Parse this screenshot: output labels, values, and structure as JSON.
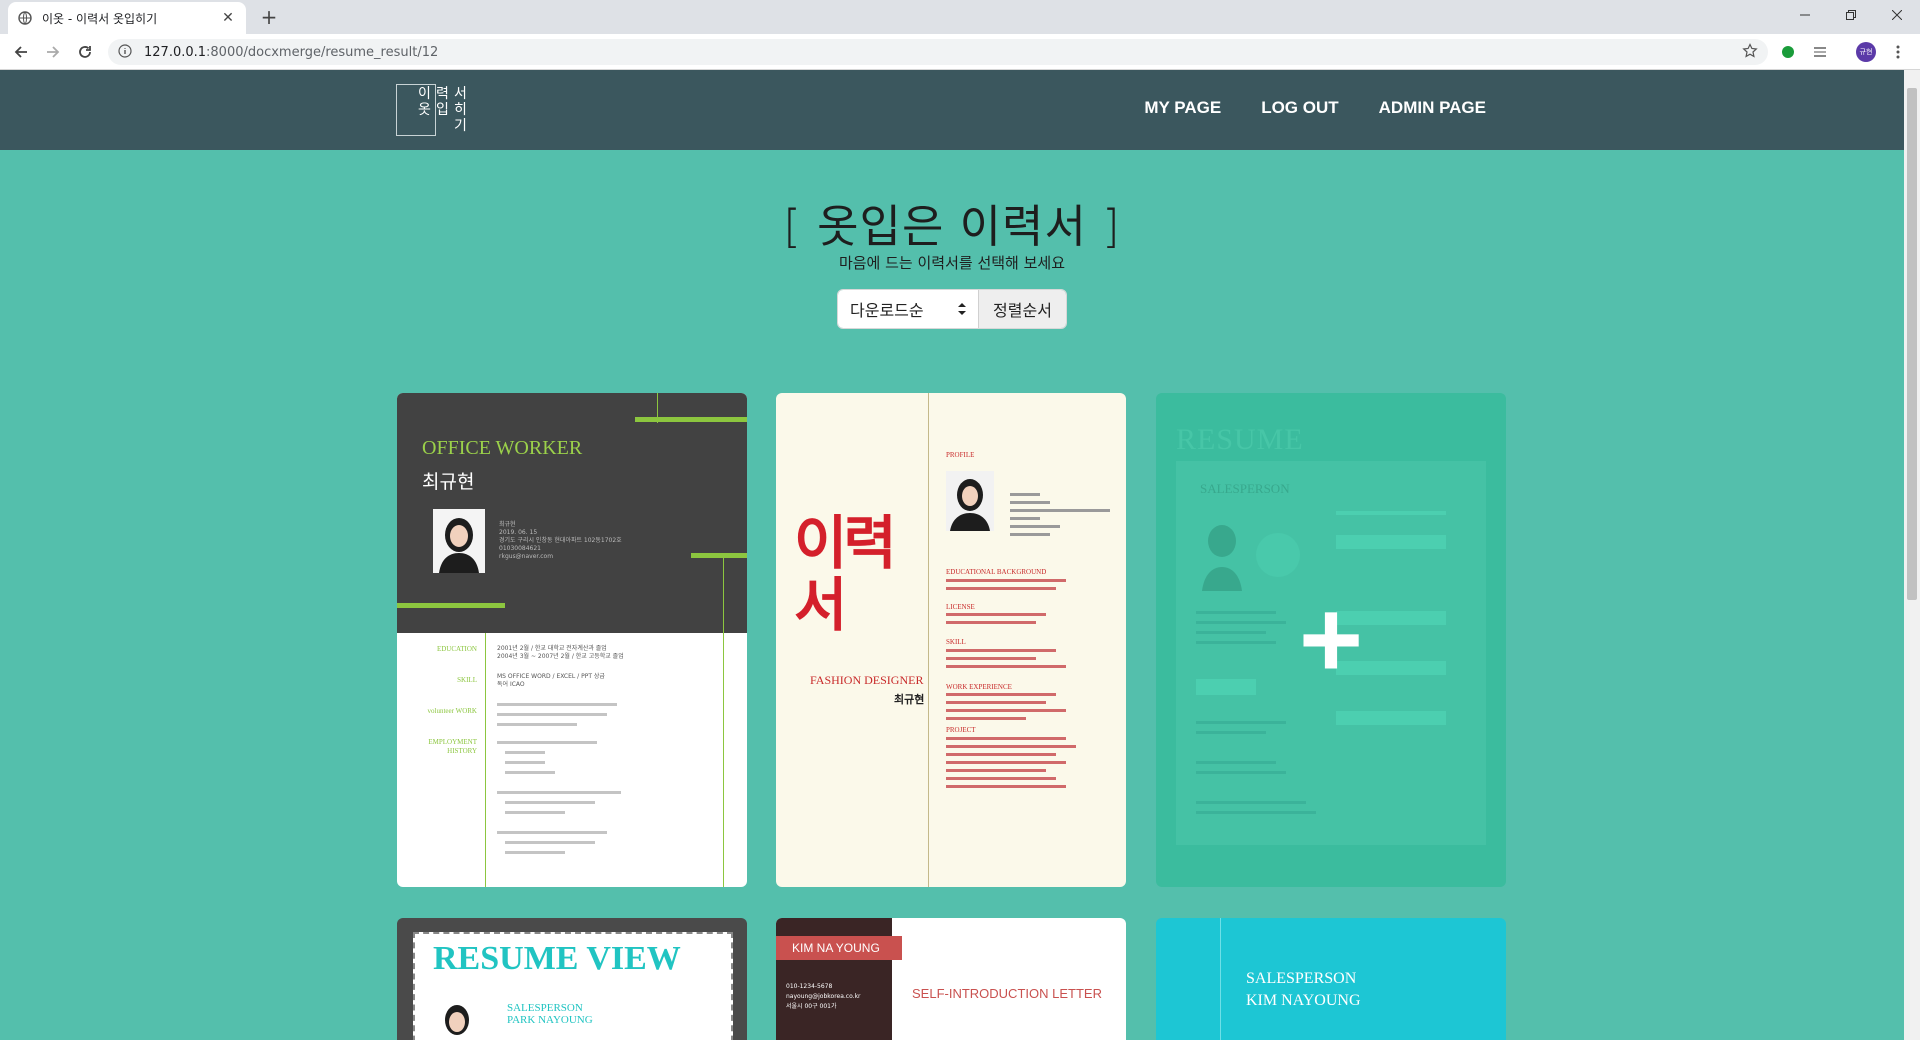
{
  "browser": {
    "tab_title": "이옷 - 이력서 옷입히기",
    "url_host": "127.0.0.1",
    "url_rest": ":8000/docxmerge/resume_result/12",
    "new_tab_symbol": "+",
    "close_symbol": "✕",
    "ext_label": "규현"
  },
  "header": {
    "logo_chars": [
      "이",
      "옷",
      "력",
      "입",
      "서",
      "히",
      "기"
    ],
    "nav": [
      "MY PAGE",
      "LOG OUT",
      "ADMIN PAGE"
    ]
  },
  "main": {
    "title": "[ 옷입은 이력서 ]",
    "subtitle": "마음에 드는 이력서를 선택해 보세요",
    "sort_selected": "다운로드순",
    "sort_button": "정렬순서"
  },
  "cards": {
    "office": {
      "heading": "OFFICE WORKER",
      "name": "최규현",
      "info": [
        "최규현",
        "2019. 06. 15",
        "경기도 구리시 인창동 현대아파트 102동1702호",
        "01030084621",
        "rkgus@naver.com"
      ],
      "sections": [
        "EDUCATION",
        "SKILL",
        "volunteer WORK",
        "EMPLOYMENT HISTORY"
      ],
      "edu": [
        "2001년 2월 / 한교 대학교 전자계산과 졸업",
        "2004년 3월 ~ 2007년 2월 / 한교 고등학교 졸업"
      ],
      "skill": [
        "MS OFFICE WORD / EXCEL / PPT 상급",
        "독어 ICAO"
      ]
    },
    "fashion": {
      "big_chars": "이력서",
      "role": "FASHION DESIGNER",
      "name": "최규현",
      "sections": [
        "PROFILE",
        "EDUCATIONAL BACKGROUND",
        "LICENSE",
        "SKILL",
        "WORK EXPERIENCE",
        "PROJECT"
      ]
    },
    "add": {
      "watermark": "RESUME",
      "role": "SALESPERSON",
      "plus": "+"
    },
    "resume_view": {
      "title": "RESUME VIEW",
      "role": "SALESPERSON",
      "name": "PARK NAYOUNG"
    },
    "kim": {
      "tag": "KIM NA YOUNG",
      "heading": "SELF-INTRODUCTION LETTER",
      "phone": "010-1234-5678",
      "mail": "nayoung@jobkorea.co.kr",
      "addr": "서울시 00구 001가"
    },
    "sales": {
      "role": "SALESPERSON",
      "name": "KIM NAYOUNG"
    }
  },
  "colors": {
    "background": "#54bfac",
    "header": "#3b575e",
    "accent_green": "#8cc63f",
    "accent_red": "#c82a2a"
  }
}
